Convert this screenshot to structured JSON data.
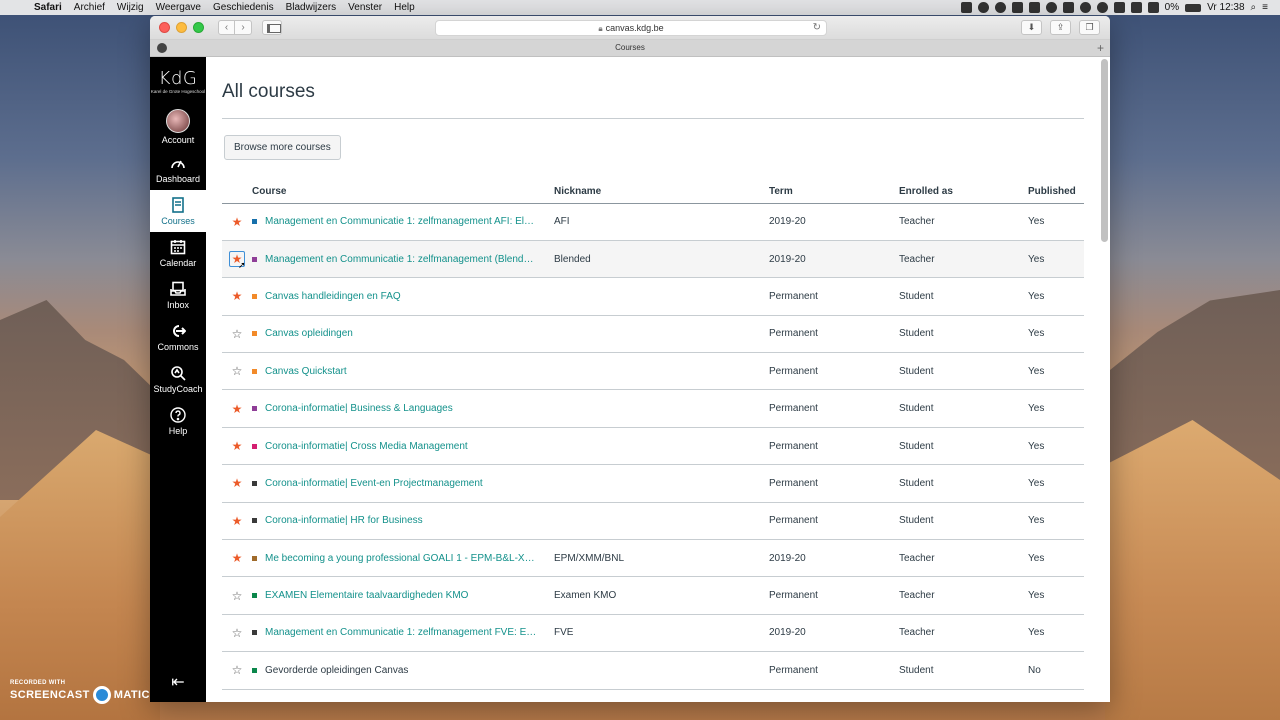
{
  "menubar": {
    "app": "Safari",
    "items": [
      "Archief",
      "Wijzig",
      "Weergave",
      "Geschiedenis",
      "Bladwijzers",
      "Venster",
      "Help"
    ],
    "battery": "0%",
    "clock": "Vr 12:38"
  },
  "browser": {
    "url": "canvas.kdg.be",
    "tab_title": "Courses"
  },
  "gnav": {
    "logo_text": "KdG",
    "logo_sub": "Karel de Grote Hogeschool",
    "items": [
      {
        "label": "Account",
        "icon": "avatar"
      },
      {
        "label": "Dashboard",
        "icon": "dashboard-icon"
      },
      {
        "label": "Courses",
        "icon": "courses-icon"
      },
      {
        "label": "Calendar",
        "icon": "calendar-icon"
      },
      {
        "label": "Inbox",
        "icon": "inbox-icon"
      },
      {
        "label": "Commons",
        "icon": "commons-icon"
      },
      {
        "label": "StudyCoach",
        "icon": "studycoach-icon"
      },
      {
        "label": "Help",
        "icon": "help-icon"
      }
    ]
  },
  "page": {
    "title": "All courses",
    "browse_button": "Browse more courses"
  },
  "table": {
    "headers": {
      "course": "Course",
      "nickname": "Nickname",
      "term": "Term",
      "enrolled": "Enrolled as",
      "published": "Published"
    },
    "rows": [
      {
        "starred": true,
        "color": "#1770ab",
        "course": "Management en Communicatie 1: zelfmanagement AFI: El…",
        "nickname": "AFI",
        "term": "2019-20",
        "enrolled": "Teacher",
        "published": "Yes",
        "link": true
      },
      {
        "starred": true,
        "color": "#8f3e97",
        "course": "Management en Communicatie 1: zelfmanagement (Blend…",
        "nickname": "Blended",
        "term": "2019-20",
        "enrolled": "Teacher",
        "published": "Yes",
        "link": true
      },
      {
        "starred": true,
        "color": "#f28a29",
        "course": "Canvas handleidingen en FAQ",
        "nickname": "",
        "term": "Permanent",
        "enrolled": "Student",
        "published": "Yes",
        "link": true
      },
      {
        "starred": false,
        "color": "#f28a29",
        "course": "Canvas opleidingen",
        "nickname": "",
        "term": "Permanent",
        "enrolled": "Student",
        "published": "Yes",
        "link": true
      },
      {
        "starred": false,
        "color": "#f28a29",
        "course": "Canvas Quickstart",
        "nickname": "",
        "term": "Permanent",
        "enrolled": "Student",
        "published": "Yes",
        "link": true
      },
      {
        "starred": true,
        "color": "#8f3e97",
        "course": "Corona-informatie| Business & Languages",
        "nickname": "",
        "term": "Permanent",
        "enrolled": "Student",
        "published": "Yes",
        "link": true
      },
      {
        "starred": true,
        "color": "#d41e70",
        "course": "Corona-informatie| Cross Media Management",
        "nickname": "",
        "term": "Permanent",
        "enrolled": "Student",
        "published": "Yes",
        "link": true
      },
      {
        "starred": true,
        "color": "#3a3a3a",
        "course": "Corona-informatie| Event-en Projectmanagement",
        "nickname": "",
        "term": "Permanent",
        "enrolled": "Student",
        "published": "Yes",
        "link": true
      },
      {
        "starred": true,
        "color": "#3a3a3a",
        "course": "Corona-informatie| HR for Business",
        "nickname": "",
        "term": "Permanent",
        "enrolled": "Student",
        "published": "Yes",
        "link": true
      },
      {
        "starred": true,
        "color": "#a06b2b",
        "course": "Me becoming a young professional GOALI 1 - EPM-B&L-X…",
        "nickname": "EPM/XMM/BNL",
        "term": "2019-20",
        "enrolled": "Teacher",
        "published": "Yes",
        "link": true
      },
      {
        "starred": false,
        "color": "#0b874b",
        "course": "EXAMEN Elementaire taalvaardigheden KMO",
        "nickname": "Examen KMO",
        "term": "Permanent",
        "enrolled": "Teacher",
        "published": "Yes",
        "link": true
      },
      {
        "starred": false,
        "color": "#3a3a3a",
        "course": "Management en Communicatie 1: zelfmanagement FVE: E…",
        "nickname": "FVE",
        "term": "2019-20",
        "enrolled": "Teacher",
        "published": "Yes",
        "link": true
      },
      {
        "starred": false,
        "color": "#0b874b",
        "course": "Gevorderde opleidingen Canvas",
        "nickname": "",
        "term": "Permanent",
        "enrolled": "Student",
        "published": "No",
        "link": false
      }
    ]
  },
  "watermark": {
    "top": "RECORDED WITH",
    "brand_left": "SCREENCAST",
    "brand_right": "MATIC"
  }
}
